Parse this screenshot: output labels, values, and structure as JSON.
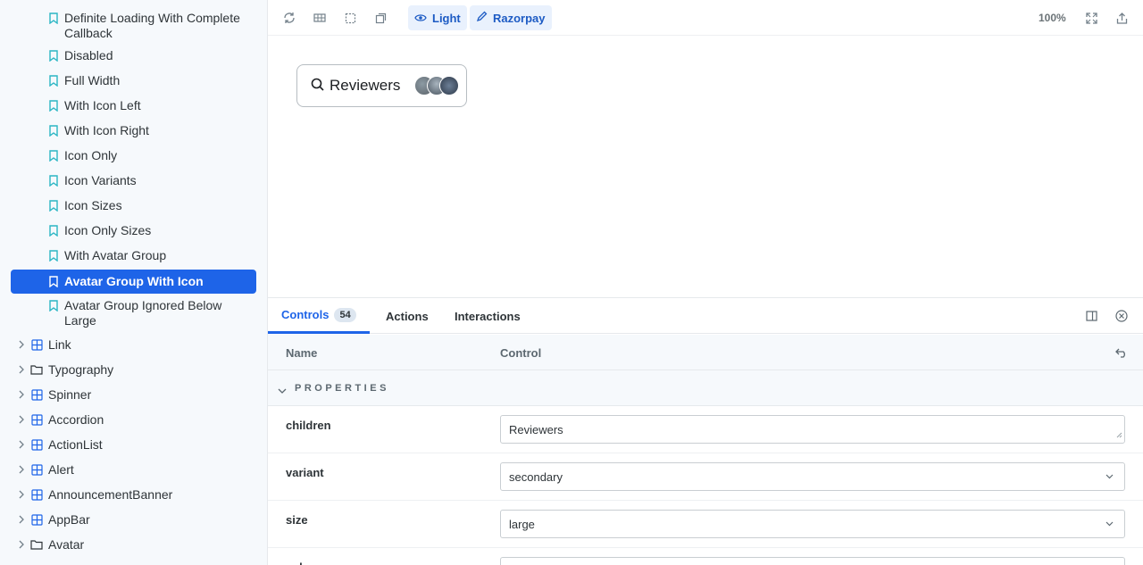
{
  "sidebar": {
    "stories": [
      {
        "label": "Definite Loading With Complete Callback",
        "active": false
      },
      {
        "label": "Disabled",
        "active": false
      },
      {
        "label": "Full Width",
        "active": false
      },
      {
        "label": "With Icon Left",
        "active": false
      },
      {
        "label": "With Icon Right",
        "active": false
      },
      {
        "label": "Icon Only",
        "active": false
      },
      {
        "label": "Icon Variants",
        "active": false
      },
      {
        "label": "Icon Sizes",
        "active": false
      },
      {
        "label": "Icon Only Sizes",
        "active": false
      },
      {
        "label": "With Avatar Group",
        "active": false
      },
      {
        "label": "Avatar Group With Icon",
        "active": true
      },
      {
        "label": "Avatar Group Ignored Below Large",
        "active": false
      }
    ],
    "components": [
      {
        "label": "Link",
        "icon": "component-icon"
      },
      {
        "label": "Typography",
        "icon": "folder-icon"
      },
      {
        "label": "Spinner",
        "icon": "component-icon"
      },
      {
        "label": "Accordion",
        "icon": "component-icon"
      },
      {
        "label": "ActionList",
        "icon": "component-icon"
      },
      {
        "label": "Alert",
        "icon": "component-icon"
      },
      {
        "label": "AnnouncementBanner",
        "icon": "component-icon"
      },
      {
        "label": "AppBar",
        "icon": "component-icon"
      },
      {
        "label": "Avatar",
        "icon": "folder-icon"
      }
    ]
  },
  "toolbar": {
    "theme_label": "Light",
    "brand_label": "Razorpay",
    "zoom": "100%"
  },
  "preview": {
    "button_label": "Reviewers"
  },
  "panel": {
    "tabs": [
      {
        "label": "Controls",
        "badge": "54"
      },
      {
        "label": "Actions"
      },
      {
        "label": "Interactions"
      }
    ],
    "header_name": "Name",
    "header_control": "Control",
    "section_title": "PROPERTIES",
    "rows": [
      {
        "name": "children",
        "value": "Reviewers",
        "type": "text"
      },
      {
        "name": "variant",
        "value": "secondary",
        "type": "select"
      },
      {
        "name": "size",
        "value": "large",
        "type": "select"
      },
      {
        "name": "color",
        "value": "",
        "type": "select"
      }
    ]
  },
  "colors": {
    "accent": "#1e64e8",
    "bookmark": "#2bb6c4",
    "sidebar_bg": "#f6f9fc"
  }
}
